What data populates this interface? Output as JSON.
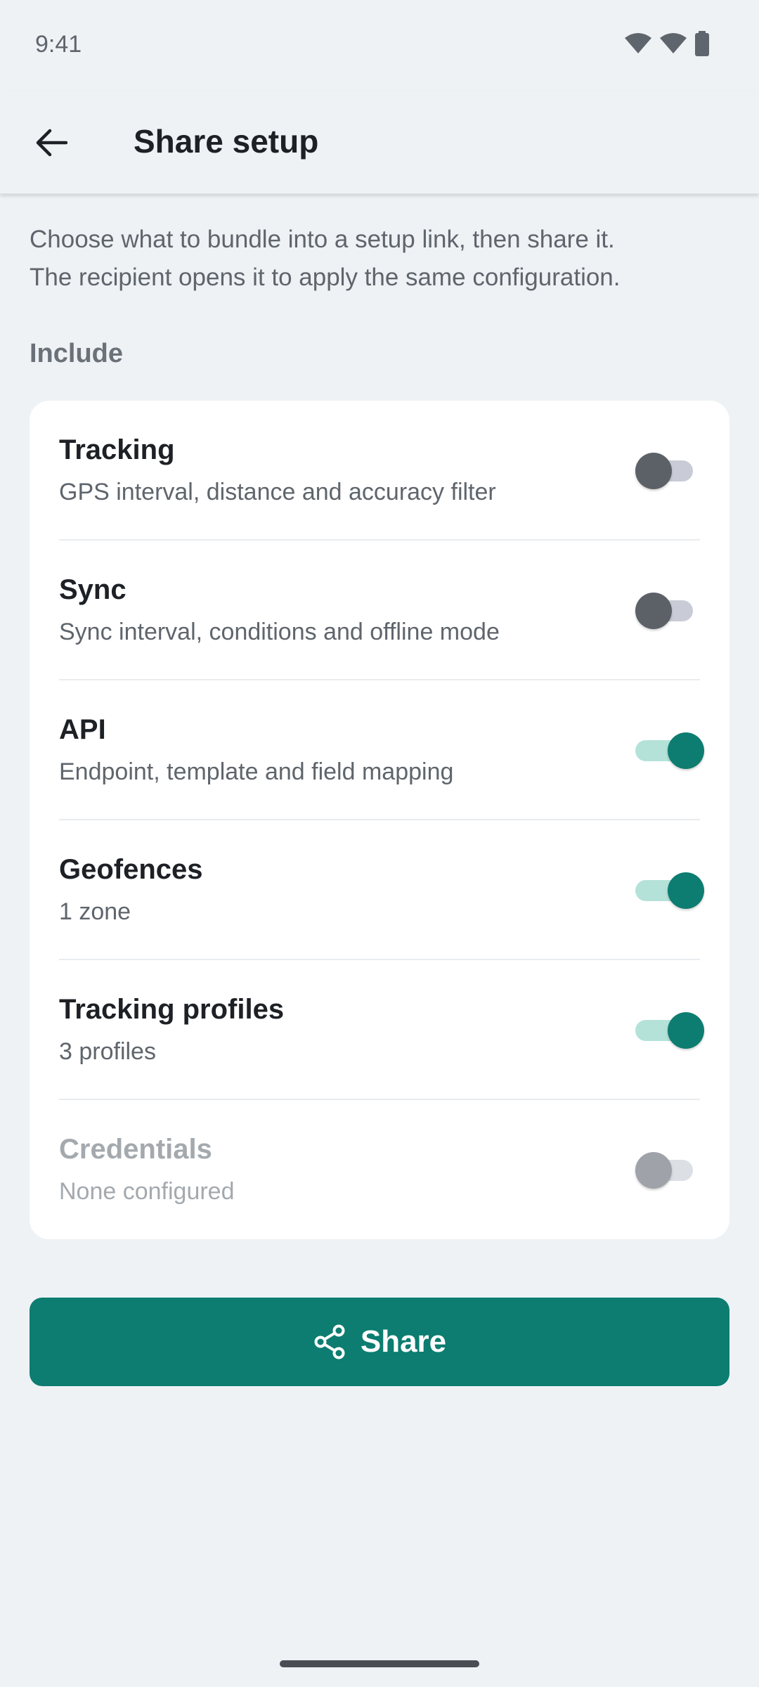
{
  "status_bar": {
    "time": "9:41",
    "icons": [
      "wifi-icon",
      "signal-icon",
      "battery-icon"
    ]
  },
  "app_bar": {
    "title": "Share setup",
    "back_icon": "arrow-back-icon"
  },
  "description": "Choose what to bundle into a setup link, then share it.\nThe recipient opens it to apply the same configuration.",
  "section_label": "Include",
  "options": [
    {
      "title": "Tracking",
      "subtitle": "GPS interval, distance and accuracy filter",
      "enabled": false,
      "disabled": false
    },
    {
      "title": "Sync",
      "subtitle": "Sync interval, conditions and offline mode",
      "enabled": false,
      "disabled": false
    },
    {
      "title": "API",
      "subtitle": "Endpoint, template and field mapping",
      "enabled": true,
      "disabled": false
    },
    {
      "title": "Geofences",
      "subtitle": "1 zone",
      "enabled": true,
      "disabled": false
    },
    {
      "title": "Tracking profiles",
      "subtitle": "3 profiles",
      "enabled": true,
      "disabled": false
    },
    {
      "title": "Credentials",
      "subtitle": "None configured",
      "enabled": false,
      "disabled": true
    }
  ],
  "share_button": {
    "label": "Share",
    "icon": "share-icon"
  },
  "colors": {
    "accent": "#0c7d70",
    "background": "#eef2f5",
    "card": "#ffffff"
  }
}
